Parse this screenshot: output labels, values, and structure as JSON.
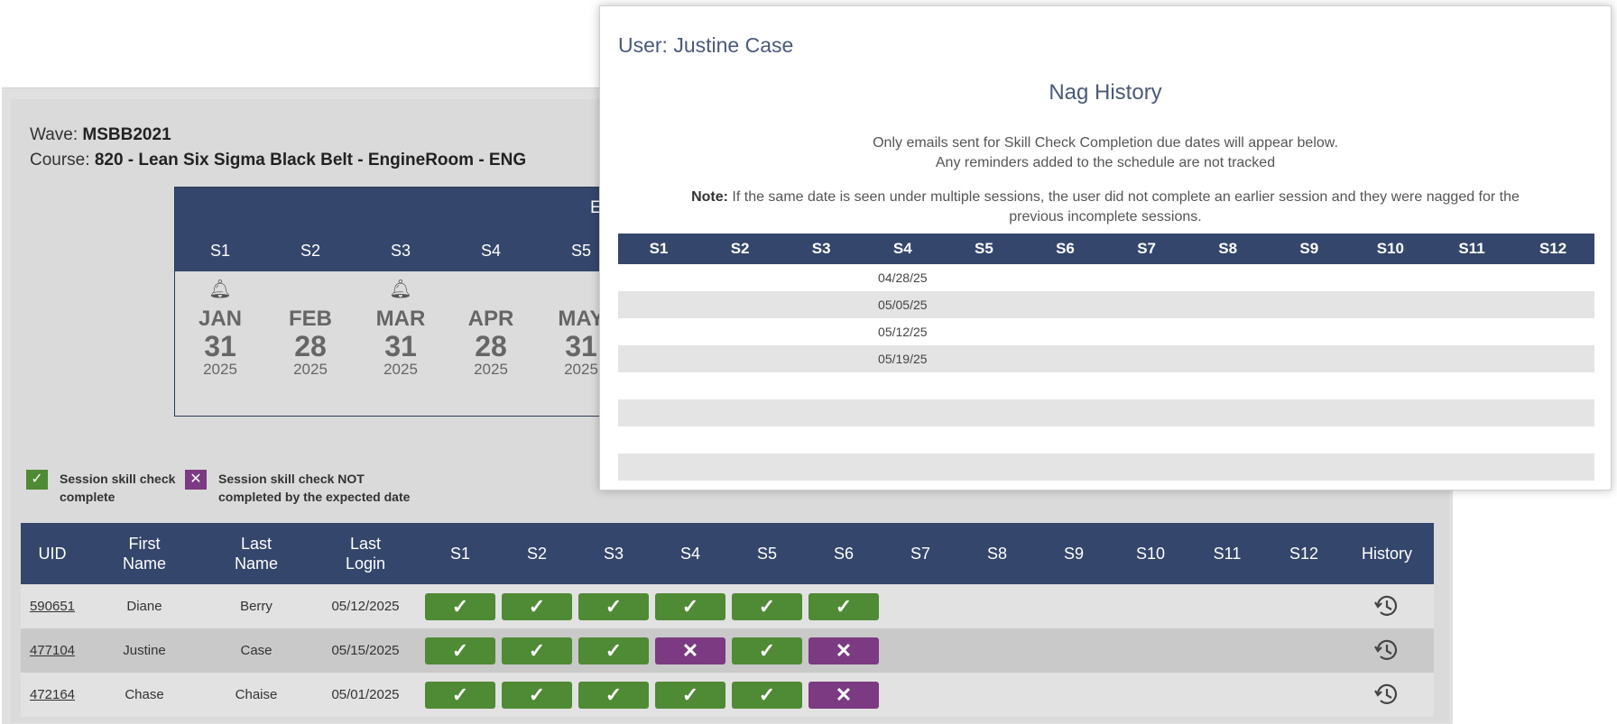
{
  "wave": {
    "label": "Wave:",
    "value": "MSBB2021"
  },
  "course": {
    "label": "Course:",
    "value": "820 - Lean Six Sigma Black Belt - EngineRoom - ENG"
  },
  "calendar": {
    "title": "E",
    "sessions": [
      {
        "s": "S1",
        "bell": true,
        "month": "JAN",
        "day": "31",
        "year": "2025"
      },
      {
        "s": "S2",
        "bell": false,
        "month": "FEB",
        "day": "28",
        "year": "2025"
      },
      {
        "s": "S3",
        "bell": true,
        "month": "MAR",
        "day": "31",
        "year": "2025"
      },
      {
        "s": "S4",
        "bell": false,
        "month": "APR",
        "day": "28",
        "year": "2025"
      },
      {
        "s": "S5",
        "bell": false,
        "month": "MAY",
        "day": "31",
        "year": "2025"
      }
    ]
  },
  "legend": {
    "complete_icon": "check-icon",
    "complete": "Session skill check complete",
    "notcomplete_icon": "x-icon",
    "notcomplete": "Session skill check NOT completed by the expected date",
    "complete_color": "#4f8a34",
    "notcomplete_color": "#7b3a82"
  },
  "table": {
    "headers": [
      "UID",
      "First Name",
      "Last Name",
      "Last Login",
      "S1",
      "S2",
      "S3",
      "S4",
      "S5",
      "S6",
      "S7",
      "S8",
      "S9",
      "S10",
      "S11",
      "S12",
      "History"
    ],
    "header_color": "#34466b",
    "rows": [
      {
        "uid": "590651",
        "first": "Diane",
        "last": "Berry",
        "login": "05/12/2025",
        "s": [
          "c",
          "c",
          "c",
          "c",
          "c",
          "c"
        ]
      },
      {
        "uid": "477104",
        "first": "Justine",
        "last": "Case",
        "login": "05/15/2025",
        "s": [
          "c",
          "c",
          "c",
          "x",
          "c",
          "x"
        ]
      },
      {
        "uid": "472164",
        "first": "Chase",
        "last": "Chaise",
        "login": "05/01/2025",
        "s": [
          "c",
          "c",
          "c",
          "c",
          "c",
          "x"
        ]
      }
    ]
  },
  "modal": {
    "user": "User: Justine Case",
    "title": "Nag History",
    "note1": "Only emails sent for Skill Check Completion due dates will appear below.",
    "note2": "Any reminders added to the schedule are not tracked",
    "note_label": "Note:",
    "note_text": "If the same date is seen under multiple sessions, the user did not complete an earlier session and they were nagged for the",
    "note_text2": "previous incomplete sessions.",
    "headers": [
      "S1",
      "S2",
      "S3",
      "S4",
      "S5",
      "S6",
      "S7",
      "S8",
      "S9",
      "S10",
      "S11",
      "S12"
    ],
    "s4_dates": [
      "04/28/25",
      "05/05/25",
      "05/12/25",
      "05/19/25",
      "",
      "",
      "",
      ""
    ]
  }
}
